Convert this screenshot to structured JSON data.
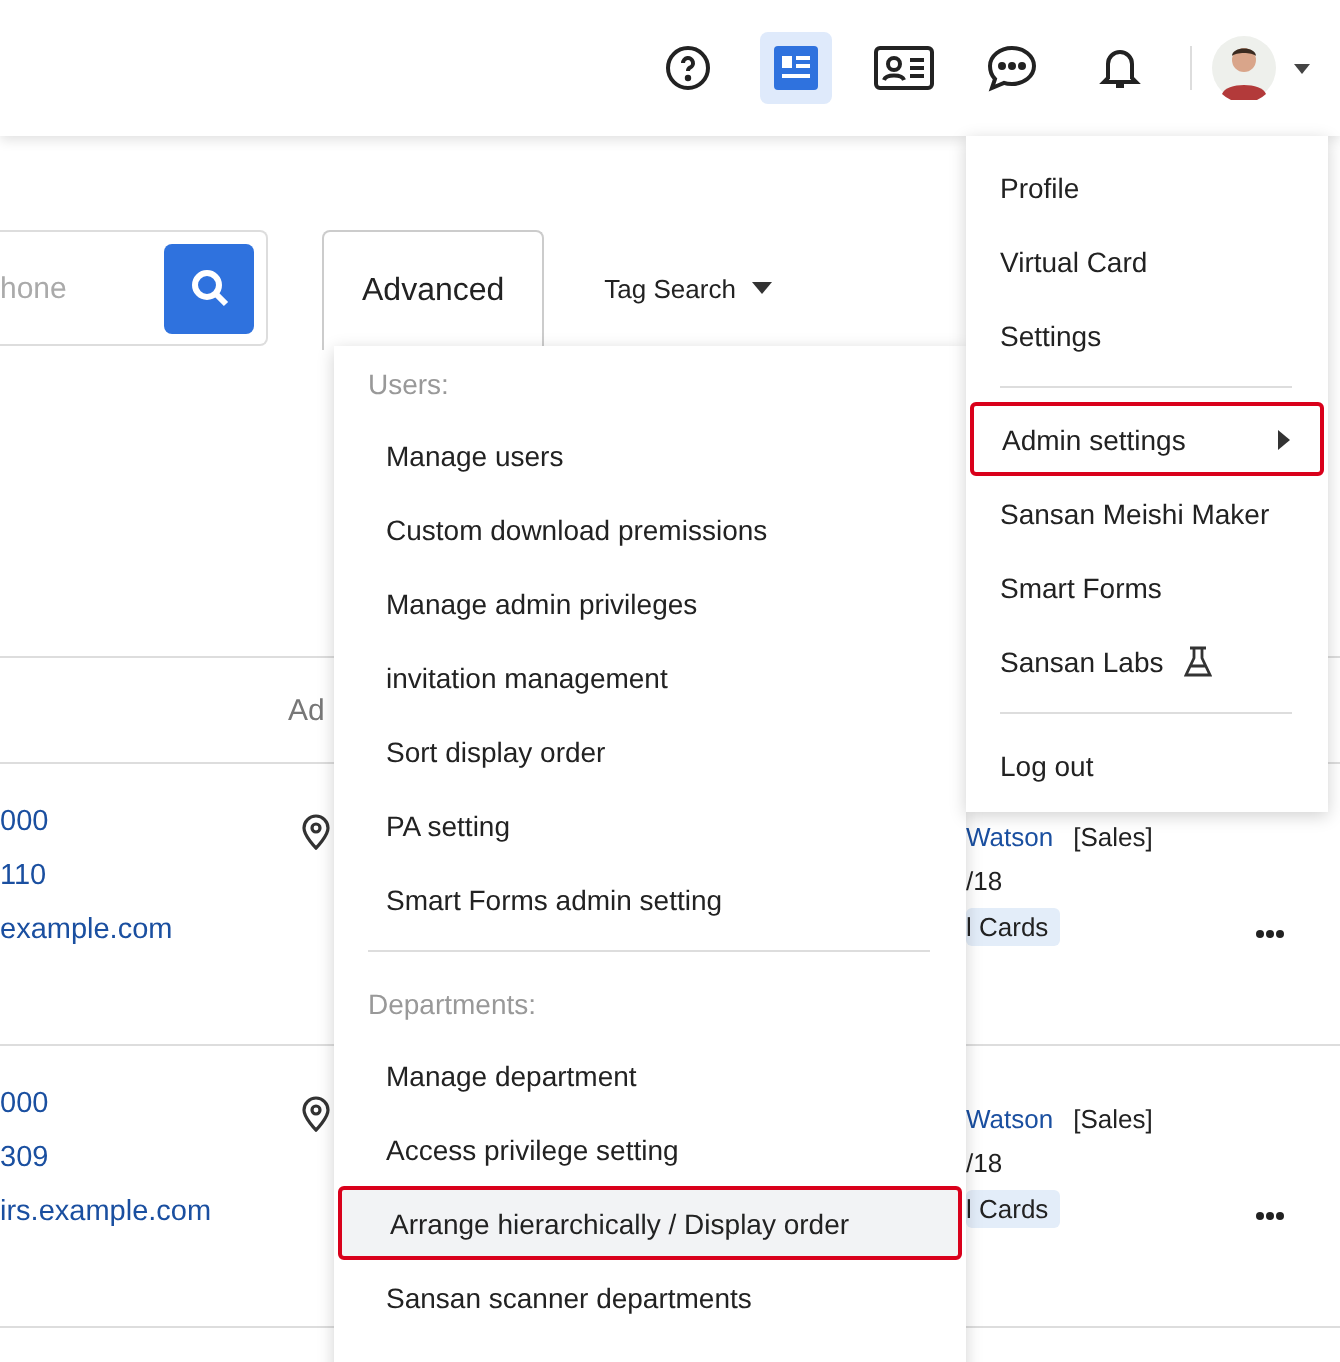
{
  "header": {
    "view_buttons": [
      {
        "selected": true
      },
      {
        "selected": false
      }
    ]
  },
  "search": {
    "placeholder": "hone"
  },
  "tabs": [
    {
      "label": "Advanced",
      "selected": true
    },
    {
      "label": "Tag Search",
      "selected": false
    }
  ],
  "table": {
    "columns": [
      "Ad"
    ],
    "rows": [
      {
        "lines": [
          "000",
          "110",
          "example.com"
        ],
        "owner": "Watson",
        "department": "[Sales]",
        "date": "/18",
        "tag": "l Cards"
      },
      {
        "lines": [
          "000",
          "309",
          "irs.example.com"
        ],
        "owner": "Watson",
        "department": "[Sales]",
        "date": "/18",
        "tag": "l Cards"
      }
    ]
  },
  "advanced_menu": {
    "sections": [
      {
        "heading": "Users:",
        "items": [
          {
            "label": "Manage users",
            "selected": false
          },
          {
            "label": "Custom download premissions",
            "selected": false
          },
          {
            "label": "Manage admin privileges",
            "selected": false
          },
          {
            "label": "invitation management",
            "selected": false
          },
          {
            "label": "Sort display order",
            "selected": false
          },
          {
            "label": "PA setting",
            "selected": false
          },
          {
            "label": "Smart Forms admin setting",
            "selected": false
          }
        ]
      },
      {
        "heading": "Departments:",
        "items": [
          {
            "label": "Manage department",
            "selected": false
          },
          {
            "label": "Access privilege setting",
            "selected": false
          },
          {
            "label": "Arrange hierarchically / Display order",
            "selected": true
          },
          {
            "label": "Sansan scanner departments",
            "selected": false
          }
        ]
      }
    ]
  },
  "profile_menu": {
    "groups": [
      [
        {
          "label": "Profile",
          "kind": "link",
          "selected": false
        },
        {
          "label": "Virtual Card",
          "kind": "link",
          "selected": false
        },
        {
          "label": "Settings",
          "kind": "link",
          "selected": false
        }
      ],
      [
        {
          "label": "Admin settings",
          "kind": "submenu",
          "selected": true
        },
        {
          "label": "Sansan Meishi Maker",
          "kind": "link",
          "selected": false
        },
        {
          "label": "Smart Forms",
          "kind": "link",
          "selected": false
        },
        {
          "label": "Sansan Labs",
          "kind": "labs",
          "selected": false
        }
      ],
      [
        {
          "label": "Log out",
          "kind": "link",
          "selected": false
        }
      ]
    ]
  }
}
